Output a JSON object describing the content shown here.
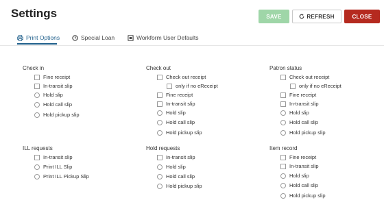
{
  "header": {
    "title": "Settings",
    "save_label": "SAVE",
    "refresh_label": "REFRESH",
    "close_label": "CLOSE",
    "colors": {
      "save": "#9fd6a8",
      "close": "#b52a1f",
      "accent": "#1f5f8b"
    }
  },
  "tabs": [
    {
      "label": "Print Options",
      "icon": "printer-icon",
      "active": true
    },
    {
      "label": "Special Loan",
      "icon": "clock-icon",
      "active": false
    },
    {
      "label": "Workform User Defaults",
      "icon": "form-icon",
      "active": false
    }
  ],
  "sections": {
    "check_in": {
      "title": "Check in",
      "fine_receipt": "Fine receipt",
      "in_transit_slip": "In-transit slip",
      "hold_slip": "Hold slip",
      "hold_call_slip": "Hold call slip",
      "hold_pickup_slip": "Hold pickup slip"
    },
    "check_out": {
      "title": "Check out",
      "check_out_receipt": "Check out receipt",
      "only_if_no_ereceipt": "only if no eReceipt",
      "fine_receipt": "Fine receipt",
      "in_transit_slip": "In-transit slip",
      "hold_slip": "Hold slip",
      "hold_call_slip": "Hold call slip",
      "hold_pickup_slip": "Hold pickup slip"
    },
    "patron_status": {
      "title": "Patron status",
      "check_out_receipt": "Check out receipt",
      "only_if_no_ereceipt": "only if no eReceipt",
      "fine_receipt": "Fine receipt",
      "in_transit_slip": "In-transit slip",
      "hold_slip": "Hold slip",
      "hold_call_slip": "Hold call slip",
      "hold_pickup_slip": "Hold pickup slip"
    },
    "ill_requests": {
      "title": "ILL requests",
      "in_transit_slip": "In-transit slip",
      "print_ill_slip": "Print ILL Slip",
      "print_ill_pickup_slip": "Print ILL Pickup Slip"
    },
    "hold_requests": {
      "title": "Hold requests",
      "in_transit_slip": "In-transit slip",
      "hold_slip": "Hold slip",
      "hold_call_slip": "Hold call slip",
      "hold_pickup_slip": "Hold pickup slip"
    },
    "item_record": {
      "title": "Item record",
      "fine_receipt": "Fine receipt",
      "in_transit_slip": "In-transit slip",
      "hold_slip": "Hold slip",
      "hold_call_slip": "Hold call slip",
      "hold_pickup_slip": "Hold pickup slip"
    }
  }
}
